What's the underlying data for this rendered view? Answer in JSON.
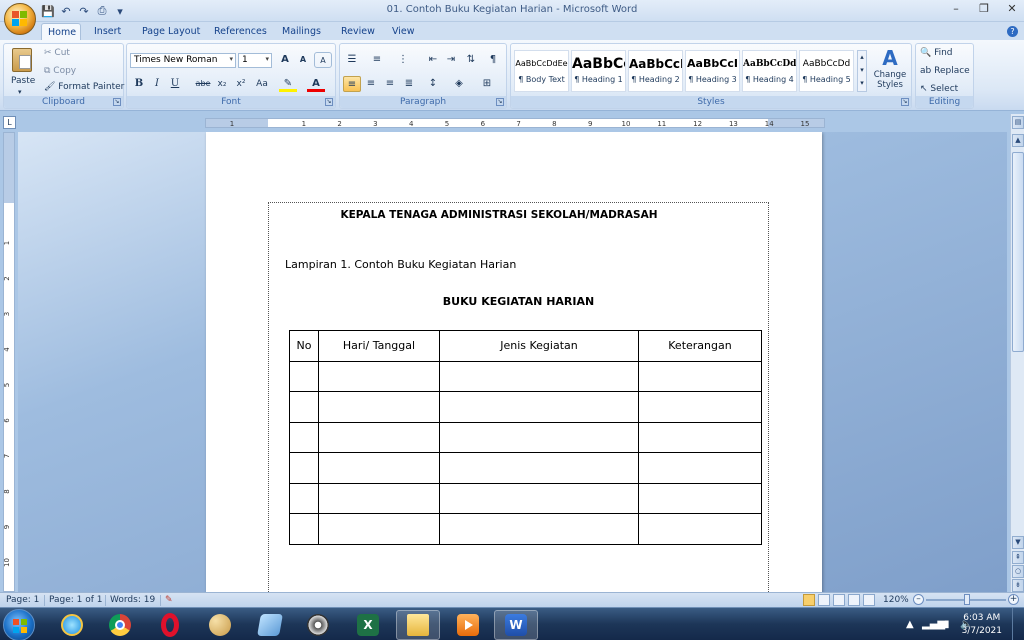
{
  "window": {
    "title": "01. Contoh Buku Kegiatan Harian - Microsoft Word",
    "minimize": "–",
    "maximize": "❐",
    "close": "✕"
  },
  "tabs": [
    "Home",
    "Insert",
    "Page Layout",
    "References",
    "Mailings",
    "Review",
    "View"
  ],
  "active_tab": "Home",
  "ribbon": {
    "clipboard": {
      "label": "Clipboard",
      "paste": "Paste",
      "cut": "Cut",
      "copy": "Copy",
      "format_painter": "Format Painter"
    },
    "font": {
      "label": "Font",
      "font_name": "Times New Roman",
      "font_size": "1",
      "bold": "B",
      "italic": "I",
      "underline": "U",
      "strike": "abe",
      "subscript": "x₂",
      "superscript": "x²",
      "change_case": "Aa",
      "grow": "A",
      "shrink": "A",
      "clear": "A",
      "font_color": "A"
    },
    "paragraph": {
      "label": "Paragraph"
    },
    "styles": {
      "label": "Styles",
      "items": [
        {
          "sample": "AaBbCcDdEe",
          "name": "¶ Body Text"
        },
        {
          "sample": "AaBbCc",
          "name": "¶ Heading 1"
        },
        {
          "sample": "AaBbCcI",
          "name": "¶ Heading 2"
        },
        {
          "sample": "AaBbCcI",
          "name": "¶ Heading 3"
        },
        {
          "sample": "AaBbCcDd",
          "name": "¶ Heading 4"
        },
        {
          "sample": "AaBbCcDd",
          "name": "¶ Heading 5"
        }
      ],
      "change_styles_1": "Change",
      "change_styles_2": "Styles"
    },
    "editing": {
      "label": "Editing",
      "find": "Find",
      "replace": "Replace",
      "select": "Select"
    }
  },
  "document": {
    "heading": "KEPALA TENAGA ADMINISTRASI SEKOLAH/MADRASAH",
    "paragraph": "Lampiran 1. Contoh Buku Kegiatan Harian",
    "title": "BUKU KEGIATAN  HARIAN",
    "table": {
      "headers": [
        "No",
        "Hari/ Tanggal",
        "Jenis Kegiatan",
        "Keterangan"
      ],
      "empty_rows": 6
    }
  },
  "ruler": {
    "h_labels": [
      "1",
      "1",
      "2",
      "3",
      "4",
      "5",
      "6",
      "7",
      "8",
      "9",
      "10",
      "11",
      "12",
      "13",
      "14",
      "15"
    ],
    "v_labels": [
      "1",
      "2",
      "3",
      "4",
      "5",
      "6",
      "7",
      "8",
      "9",
      "10"
    ]
  },
  "status": {
    "page": "Page: 1",
    "page_of": "Page: 1 of 1",
    "words": "Words: 19",
    "zoom": "120%"
  },
  "clock": {
    "time": "6:03 AM",
    "date": "3/7/2021"
  },
  "colors": {
    "accent": "#15428b",
    "ribbon_bg": "#dce8f6",
    "taskbar": "#1d3658"
  }
}
